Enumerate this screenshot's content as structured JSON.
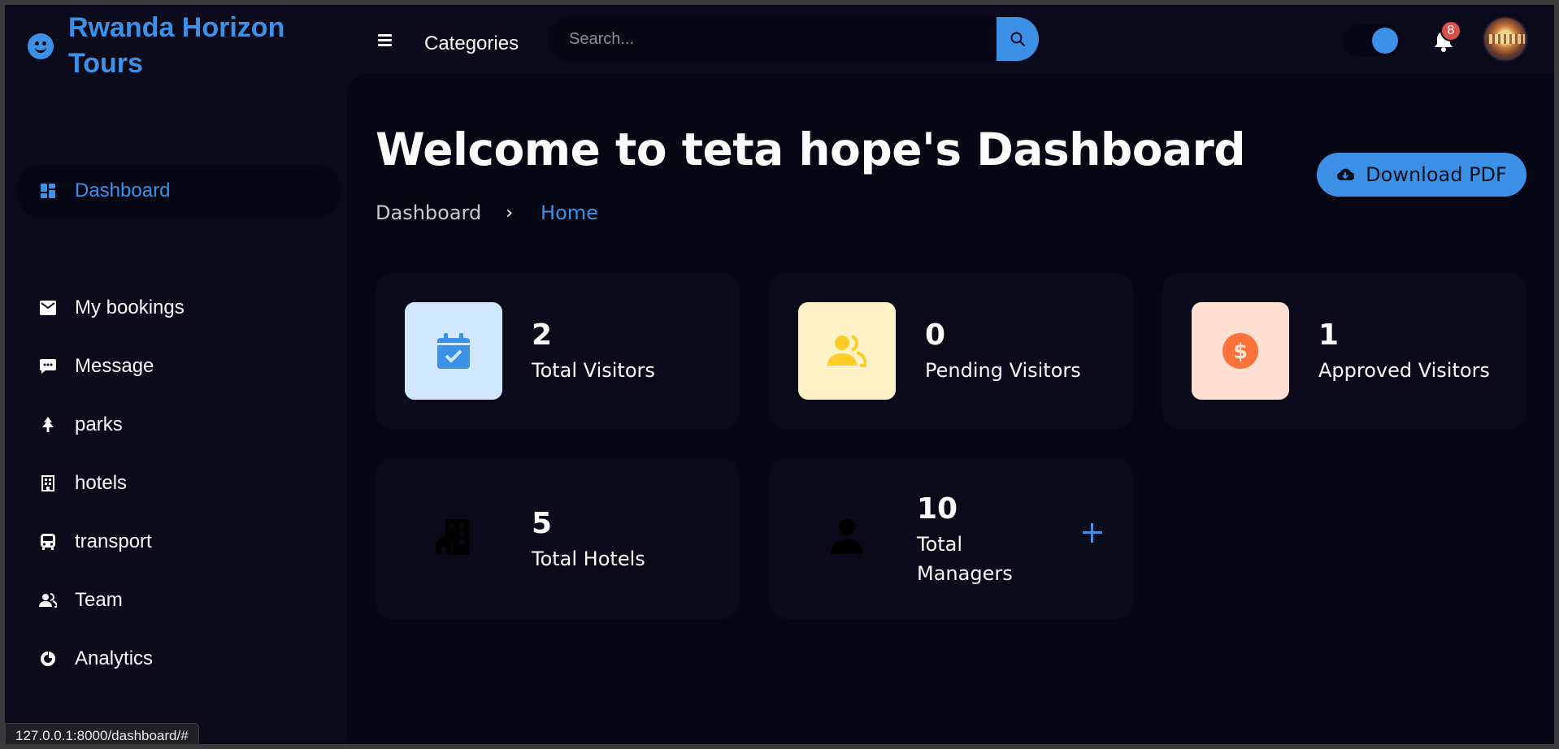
{
  "brand": {
    "name": "Rwanda Horizon Tours",
    "icon": "smile-icon"
  },
  "topbar": {
    "categories_label": "Categories",
    "search": {
      "placeholder": "Search...",
      "value": ""
    },
    "notifications_count": "8"
  },
  "sidebar": {
    "items": [
      {
        "label": "Dashboard",
        "icon": "dashboard-icon",
        "active": true
      },
      {
        "label": "My bookings",
        "icon": "envelope-icon"
      },
      {
        "label": "Message",
        "icon": "chat-icon"
      },
      {
        "label": "parks",
        "icon": "tree-icon"
      },
      {
        "label": "hotels",
        "icon": "building-icon"
      },
      {
        "label": "transport",
        "icon": "bus-icon"
      },
      {
        "label": "Team",
        "icon": "group-icon"
      },
      {
        "label": "Analytics",
        "icon": "pie-chart-icon"
      }
    ]
  },
  "main": {
    "title": "Welcome to teta hope's Dashboard",
    "breadcrumb": {
      "parent": "Dashboard",
      "current": "Home"
    },
    "download_label": "Download PDF",
    "stats": [
      {
        "value": "2",
        "label": "Total Visitors",
        "icon": "calendar-check-icon"
      },
      {
        "value": "0",
        "label": "Pending Visitors",
        "icon": "group-icon"
      },
      {
        "value": "1",
        "label": "Approved Visitors",
        "icon": "dollar-circle-icon"
      },
      {
        "value": "5",
        "label": "Total Hotels",
        "icon": "building-icon"
      },
      {
        "value": "10",
        "label_line1": "Total",
        "label_line2": "Managers",
        "icon": "user-icon"
      }
    ]
  },
  "status_bar": {
    "url": "127.0.0.1:8000/dashboard/#"
  },
  "colors": {
    "accent": "#3c91e6",
    "background": "#060714",
    "panel": "#0b0a1a",
    "light_blue": "#cfe8ff",
    "light_yellow": "#fff2c6",
    "light_orange": "#ffe0d3",
    "orange": "#fd7238",
    "yellow": "#ffce26",
    "red": "#db504a"
  }
}
